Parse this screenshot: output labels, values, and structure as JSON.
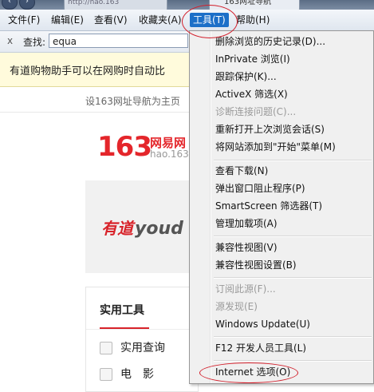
{
  "titlebar": {
    "tab_url": "http://hao.163",
    "tab_site": "163网址导航"
  },
  "menubar": {
    "items": [
      "文件(F)",
      "编辑(E)",
      "查看(V)",
      "收藏夹(A)",
      "工具(T)",
      "帮助(H)"
    ],
    "active_index": 4
  },
  "findbar": {
    "close": "x",
    "label": "查找:",
    "value": "equa"
  },
  "notification": {
    "text": "有道购物助手可以在网购时自动比"
  },
  "page": {
    "set_home": "设163网址导航为主页",
    "logo_num": "163",
    "logo_cn": "网易网",
    "logo_en": "hao.163",
    "youdao_cn": "有道",
    "youdao_en": "youd",
    "tools_title": "实用工具",
    "tool_items": [
      "实用查询",
      "电　影"
    ]
  },
  "menu": {
    "items": [
      {
        "label": "删除浏览的历史记录(D)...",
        "enabled": true
      },
      {
        "label": "InPrivate 浏览(I)",
        "enabled": true
      },
      {
        "label": "跟踪保护(K)...",
        "enabled": true
      },
      {
        "label": "ActiveX 筛选(X)",
        "enabled": true
      },
      {
        "label": "诊断连接问题(C)...",
        "enabled": false
      },
      {
        "label": "重新打开上次浏览会话(S)",
        "enabled": true
      },
      {
        "label": "将网站添加到\"开始\"菜单(M)",
        "enabled": true
      },
      {
        "label": "查看下载(N)",
        "enabled": true
      },
      {
        "label": "弹出窗口阻止程序(P)",
        "enabled": true
      },
      {
        "label": "SmartScreen 筛选器(T)",
        "enabled": true
      },
      {
        "label": "管理加载项(A)",
        "enabled": true
      },
      {
        "label": "兼容性视图(V)",
        "enabled": true
      },
      {
        "label": "兼容性视图设置(B)",
        "enabled": true
      },
      {
        "label": "订阅此源(F)...",
        "enabled": false
      },
      {
        "label": "源发现(E)",
        "enabled": false
      },
      {
        "label": "Windows Update(U)",
        "enabled": true
      },
      {
        "label": "F12 开发人员工具(L)",
        "enabled": true
      },
      {
        "label": "Internet 选项(O)",
        "enabled": true
      }
    ]
  },
  "colors": {
    "menu_active": "#1c6fc8",
    "annotation": "#d21e2a",
    "notify_bg": "#fffbdc"
  }
}
